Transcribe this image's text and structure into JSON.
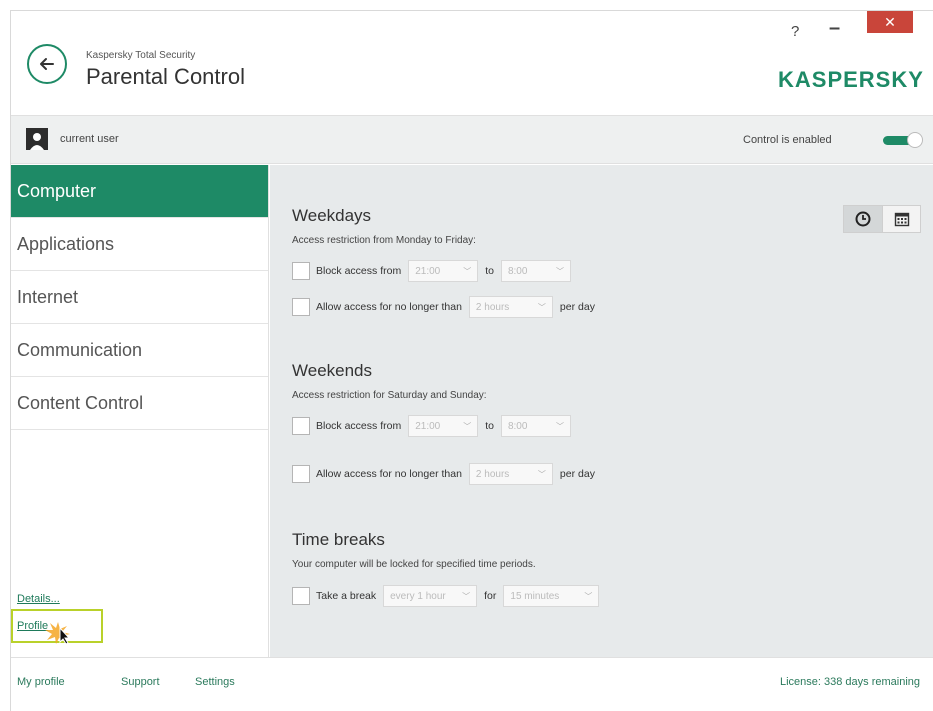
{
  "header": {
    "app_name": "Kaspersky Total Security",
    "title": "Parental Control",
    "help": "?",
    "minimize": "–",
    "close": "✕",
    "logo": "KASPERSKY"
  },
  "user_bar": {
    "user_name": "current user",
    "control_label": "Control is enabled",
    "control_enabled": true
  },
  "sidebar": {
    "items": [
      {
        "label": "Computer",
        "active": true
      },
      {
        "label": "Applications",
        "active": false
      },
      {
        "label": "Internet",
        "active": false
      },
      {
        "label": "Communication",
        "active": false
      },
      {
        "label": "Content Control",
        "active": false
      }
    ],
    "details_link": "Details...",
    "profile_link": "Profile"
  },
  "weekdays": {
    "title": "Weekdays",
    "subtitle": "Access restriction from Monday to Friday:",
    "block_label": "Block access from",
    "block_from": "21:00",
    "to_label": "to",
    "block_to": "8:00",
    "allow_label": "Allow access for no longer than",
    "allow_value": "2 hours",
    "per_day": "per day"
  },
  "weekends": {
    "title": "Weekends",
    "subtitle": "Access restriction for Saturday and Sunday:",
    "block_label": "Block access from",
    "block_from": "21:00",
    "to_label": "to",
    "block_to": "8:00",
    "allow_label": "Allow access for no longer than",
    "allow_value": "2 hours",
    "per_day": "per day"
  },
  "time_breaks": {
    "title": "Time breaks",
    "subtitle": "Your computer will be locked for specified time periods.",
    "break_label": "Take a break",
    "every_value": "every 1 hour",
    "for_label": "for",
    "duration_value": "15 minutes"
  },
  "footer": {
    "my_profile": "My profile",
    "support": "Support",
    "settings": "Settings",
    "license": "License: 338 days remaining"
  },
  "colors": {
    "accent": "#1e8a66",
    "close_button": "#c9453a",
    "highlight": "#b9d12a"
  },
  "icons": {
    "back": "back-arrow-icon",
    "avatar": "user-avatar-icon",
    "clock_view": "clock-icon",
    "calendar_view": "calendar-icon"
  }
}
